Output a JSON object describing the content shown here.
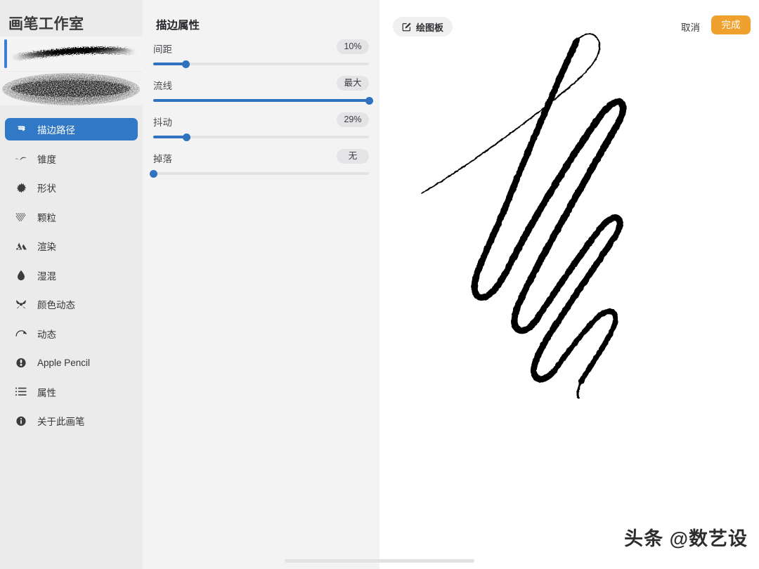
{
  "sidebar": {
    "title": "画笔工作室",
    "previews": [
      {
        "name": "brush-preview-stroke",
        "selected": true
      },
      {
        "name": "brush-preview-texture",
        "selected": false
      }
    ],
    "items": [
      {
        "label": "描边路径",
        "icon": "stroke-path-icon",
        "active": true
      },
      {
        "label": "锥度",
        "icon": "taper-wave-icon",
        "active": false
      },
      {
        "label": "形状",
        "icon": "shape-burst-icon",
        "active": false
      },
      {
        "label": "颗粒",
        "icon": "grain-dots-icon",
        "active": false
      },
      {
        "label": "渲染",
        "icon": "render-mountain-icon",
        "active": false
      },
      {
        "label": "湿混",
        "icon": "wet-mix-droplet-icon",
        "active": false
      },
      {
        "label": "颜色动态",
        "icon": "color-dynamics-icon",
        "active": false
      },
      {
        "label": "动态",
        "icon": "dynamics-gauge-icon",
        "active": false
      },
      {
        "label": "Apple Pencil",
        "icon": "apple-pencil-icon",
        "active": false
      },
      {
        "label": "属性",
        "icon": "properties-list-icon",
        "active": false
      },
      {
        "label": "关于此画笔",
        "icon": "info-circle-icon",
        "active": false
      }
    ]
  },
  "settings": {
    "title": "描边属性",
    "sliders": [
      {
        "label": "间距",
        "value": "10%",
        "percent": 15
      },
      {
        "label": "流线",
        "value": "最大",
        "percent": 100
      },
      {
        "label": "抖动",
        "value": "29%",
        "percent": 15.5
      },
      {
        "label": "掉落",
        "value": "无",
        "percent": 0
      }
    ]
  },
  "toolbar": {
    "drawpad_label": "绘图板",
    "drawpad_icon": "edit-square-pencil-icon",
    "cancel_label": "取消",
    "done_label": "完成"
  },
  "canvas": {
    "watermark": "头条 @数艺设"
  },
  "colors": {
    "accent_blue": "#3178c6",
    "slider_blue": "#2f72c0",
    "done_orange": "#f0a02c",
    "sidebar_bg": "#ebebeb",
    "settings_bg": "#f3f3f3"
  }
}
